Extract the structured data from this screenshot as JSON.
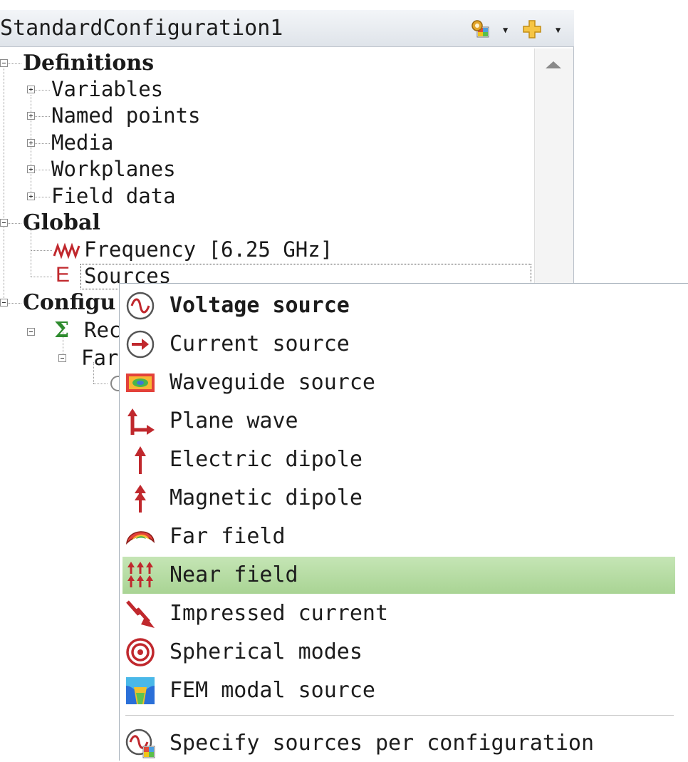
{
  "tree": {
    "header_title": "StandardConfiguration1",
    "nodes": {
      "definitions": "Definitions",
      "variables": "Variables",
      "named_points": "Named points",
      "media": "Media",
      "workplanes": "Workplanes",
      "field_data": "Field data",
      "global": "Global",
      "frequency": "Frequency [6.25 GHz]",
      "sources": "Sources",
      "configuration_partial": "Configu",
      "requests_partial": "Rec",
      "far_partial": "Far"
    }
  },
  "menu": {
    "items": [
      {
        "label": "Voltage source",
        "icon": "voltage-source-icon",
        "default": true
      },
      {
        "label": "Current source",
        "icon": "current-source-icon"
      },
      {
        "label": "Waveguide source",
        "icon": "waveguide-source-icon"
      },
      {
        "label": "Plane wave",
        "icon": "plane-wave-icon"
      },
      {
        "label": "Electric dipole",
        "icon": "electric-dipole-icon"
      },
      {
        "label": "Magnetic dipole",
        "icon": "magnetic-dipole-icon"
      },
      {
        "label": "Far field",
        "icon": "far-field-icon"
      },
      {
        "label": "Near field",
        "icon": "near-field-icon",
        "highlighted": true
      },
      {
        "label": "Impressed current",
        "icon": "impressed-current-icon"
      },
      {
        "label": "Spherical modes",
        "icon": "spherical-modes-icon"
      },
      {
        "label": "FEM modal source",
        "icon": "fem-modal-source-icon"
      }
    ],
    "footer_item": {
      "label": "Specify sources per configuration",
      "icon": "specify-sources-icon"
    }
  },
  "colors": {
    "icon_red": "#c0282d",
    "highlight_green": "#b4dca2",
    "sigma_green": "#2e8b2e"
  }
}
